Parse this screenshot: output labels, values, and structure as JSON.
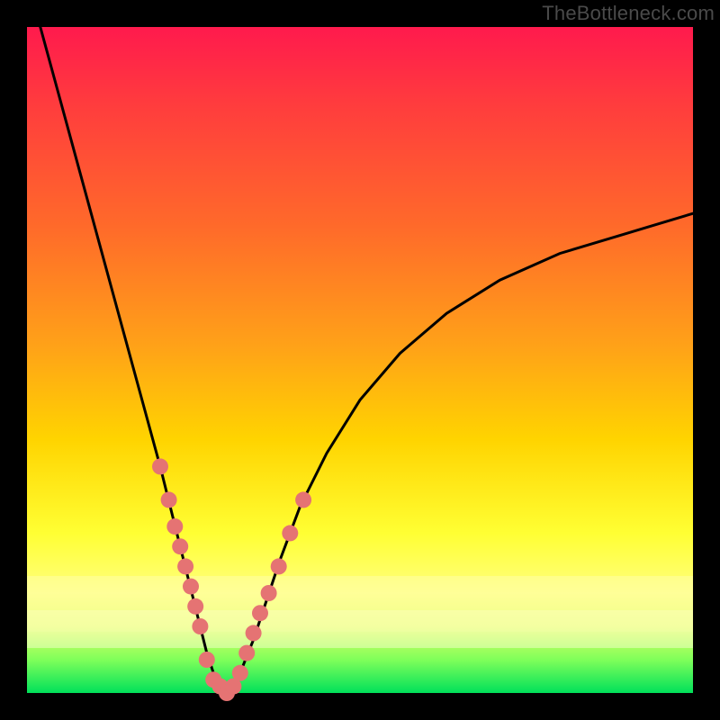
{
  "watermark": "TheBottleneck.com",
  "colors": {
    "frame": "#000000",
    "curve": "#000000",
    "marker_fill": "#e57373",
    "marker_stroke": "#c85a5a",
    "gradient_top": "#ff1a4d",
    "gradient_mid": "#ffd400",
    "gradient_bottom": "#00e05a"
  },
  "chart_data": {
    "type": "line",
    "title": "",
    "xlabel": "",
    "ylabel": "",
    "xlim": [
      0,
      100
    ],
    "ylim": [
      0,
      100
    ],
    "grid": false,
    "legend": false,
    "notes": "V-shaped bottleneck curve. Background color encodes bottleneck severity: red=high, green=low. Curve minimum (~0 bottleneck) near x≈30. Right branch asymptotes toward ~72. Pink circular markers cluster on both branches roughly where y is between ~9 and ~30, plus a flat cluster at the trough (y≈0–2).",
    "series": [
      {
        "name": "curve",
        "x": [
          2,
          5,
          8,
          11,
          14,
          17,
          20,
          22,
          24,
          26,
          27,
          28,
          29,
          30,
          31,
          32,
          34,
          36,
          38,
          41,
          45,
          50,
          56,
          63,
          71,
          80,
          90,
          100
        ],
        "y": [
          100,
          89,
          78,
          67,
          56,
          45,
          34,
          26,
          18,
          10,
          6,
          3,
          1,
          0,
          1,
          3,
          8,
          14,
          20,
          28,
          36,
          44,
          51,
          57,
          62,
          66,
          69,
          72
        ]
      }
    ],
    "markers": [
      {
        "branch": "left",
        "x": 20.0,
        "y": 34
      },
      {
        "branch": "left",
        "x": 21.3,
        "y": 29
      },
      {
        "branch": "left",
        "x": 22.2,
        "y": 25
      },
      {
        "branch": "left",
        "x": 23.0,
        "y": 22
      },
      {
        "branch": "left",
        "x": 23.8,
        "y": 19
      },
      {
        "branch": "left",
        "x": 24.6,
        "y": 16
      },
      {
        "branch": "left",
        "x": 25.3,
        "y": 13
      },
      {
        "branch": "left",
        "x": 26.0,
        "y": 10
      },
      {
        "branch": "trough",
        "x": 27.0,
        "y": 5
      },
      {
        "branch": "trough",
        "x": 28.0,
        "y": 2
      },
      {
        "branch": "trough",
        "x": 29.0,
        "y": 1
      },
      {
        "branch": "trough",
        "x": 30.0,
        "y": 0
      },
      {
        "branch": "trough",
        "x": 31.0,
        "y": 1
      },
      {
        "branch": "trough",
        "x": 32.0,
        "y": 3
      },
      {
        "branch": "right",
        "x": 33.0,
        "y": 6
      },
      {
        "branch": "right",
        "x": 34.0,
        "y": 9
      },
      {
        "branch": "right",
        "x": 35.0,
        "y": 12
      },
      {
        "branch": "right",
        "x": 36.3,
        "y": 15
      },
      {
        "branch": "right",
        "x": 37.8,
        "y": 19
      },
      {
        "branch": "right",
        "x": 39.5,
        "y": 24
      },
      {
        "branch": "right",
        "x": 41.5,
        "y": 29
      }
    ]
  }
}
